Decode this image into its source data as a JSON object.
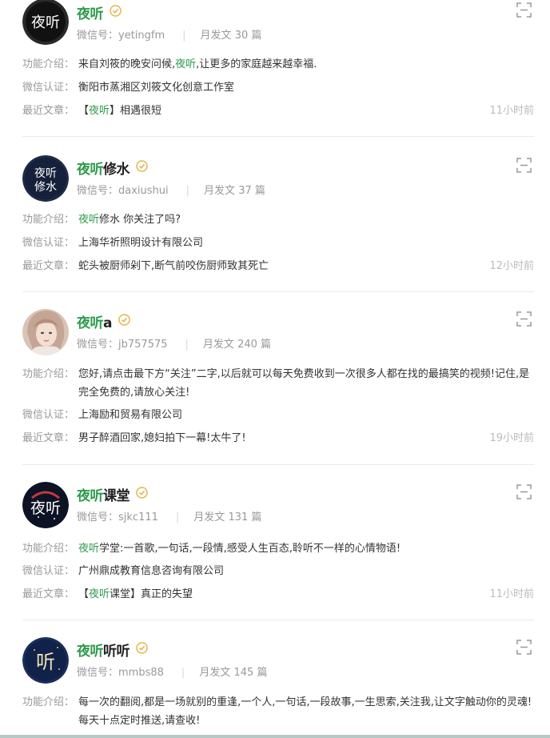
{
  "labels": {
    "intro": "功能介绍：",
    "cert": "微信认证：",
    "recent": "最近文章：",
    "wechat_id_prefix": "微信号：",
    "monthly_prefix": "月发文",
    "monthly_suffix": "篇"
  },
  "highlight": "夜听",
  "accounts": [
    {
      "name_rest": "",
      "wechat_id": "yetingfm",
      "monthly_count": "30",
      "intro_pre": "来自刘筱的晚安问候,",
      "intro_hl": "夜听",
      "intro_post": ",让更多的家庭越来越幸福.",
      "cert": "衡阳市蒸湘区刘筱文化创意工作室",
      "recent_pre": "【",
      "recent_hl": "夜听",
      "recent_post": "】相遇很短",
      "time": "11小时前",
      "avatar_text": "夜听"
    },
    {
      "name_rest": "修水",
      "wechat_id": "daxiushui",
      "monthly_count": "37",
      "intro_pre": "",
      "intro_hl": "夜听",
      "intro_post": "修水 你关注了吗?",
      "cert": "上海华祈照明设计有限公司",
      "recent_pre": "蛇头被厨师剁下,断气前咬伤厨师致其死亡",
      "recent_hl": "",
      "recent_post": "",
      "time": "12小时前",
      "avatar_text": "夜听修水"
    },
    {
      "name_rest": "a",
      "wechat_id": "jb757575",
      "monthly_count": "240",
      "intro_pre": "您好,请点击最下方“关注”二字,以后就可以每天免费收到一次很多人都在找的最搞笑的视频!记住,是完全免费的,请放心关注!",
      "intro_hl": "",
      "intro_post": "",
      "cert": "上海励和贸易有限公司",
      "recent_pre": "男子醉酒回家,媳妇拍下一幕!太牛了!",
      "recent_hl": "",
      "recent_post": "",
      "time": "19小时前",
      "avatar_text": ""
    },
    {
      "name_rest": "课堂",
      "wechat_id": "sjkc111",
      "monthly_count": "131",
      "intro_pre": "",
      "intro_hl": "夜听",
      "intro_post": "学堂:一首歌,一句话,一段情,感受人生百态,聆听不一样的心情物语!",
      "cert": "广州鼎成教育信息咨询有限公司",
      "recent_pre": "【",
      "recent_hl": "夜听",
      "recent_post": "课堂】真正的失望",
      "time": "11小时前",
      "avatar_text": "夜听"
    },
    {
      "name_rest": "听听",
      "wechat_id": "mmbs88",
      "monthly_count": "145",
      "intro_pre": "每一次的翻阅,都是一场就别的重逢,一个人,一句话,一段故事,一生思索,关注我,让文字触动你的灵魂!每天十点定时推送,请查收!",
      "intro_hl": "",
      "intro_post": "",
      "cert": "",
      "recent_pre": "",
      "recent_hl": "",
      "recent_post": "",
      "time": "",
      "avatar_text": "听"
    }
  ]
}
